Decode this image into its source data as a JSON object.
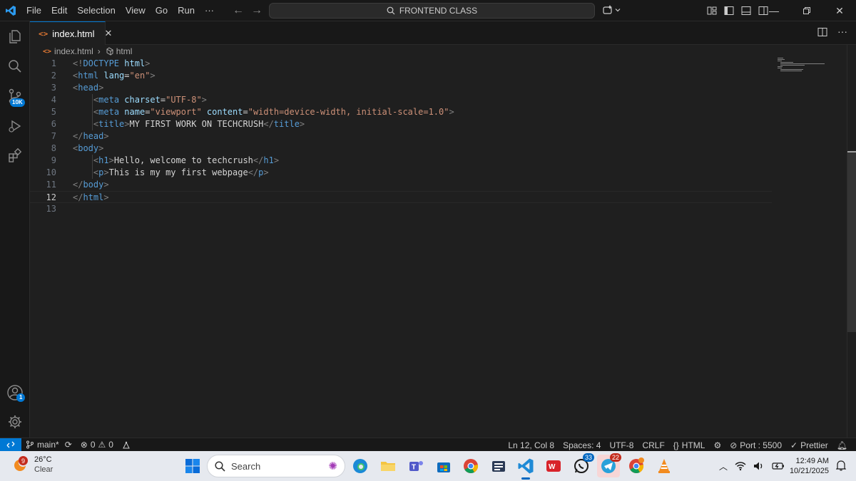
{
  "colors": {
    "accent": "#0078d4",
    "editor_bg": "#1f1f1f",
    "chrome_bg": "#181818",
    "taskbar_bg": "#e6e9ef"
  },
  "menu": [
    "File",
    "Edit",
    "Selection",
    "View",
    "Go",
    "Run",
    "···"
  ],
  "command_center": {
    "text": "FRONTEND CLASS",
    "icon": "search-icon"
  },
  "activity": {
    "source_control_badge": "10K",
    "accounts_badge": "1"
  },
  "tab": {
    "label": "index.html",
    "close": "✕"
  },
  "breadcrumb": {
    "file": "index.html",
    "symbol": "html"
  },
  "editor": {
    "current_line": "12",
    "line_numbers": [
      "1",
      "2",
      "3",
      "4",
      "5",
      "6",
      "7",
      "8",
      "9",
      "10",
      "11",
      "12",
      "13"
    ],
    "lines": [
      [
        [
          "t-tag",
          "<!"
        ],
        [
          "t-name",
          "DOCTYPE"
        ],
        [
          "t-text",
          " "
        ],
        [
          "t-attr",
          "html"
        ],
        [
          "t-tag",
          ">"
        ]
      ],
      [
        [
          "t-tag",
          "<"
        ],
        [
          "t-name",
          "html"
        ],
        [
          "t-text",
          " "
        ],
        [
          "t-attr",
          "lang"
        ],
        [
          "t-text",
          "="
        ],
        [
          "t-str",
          "\"en\""
        ],
        [
          "t-tag",
          ">"
        ]
      ],
      [
        [
          "t-tag",
          "<"
        ],
        [
          "t-name",
          "head"
        ],
        [
          "t-tag",
          ">"
        ]
      ],
      [
        [
          "t-text",
          "    "
        ],
        [
          "t-tag",
          "<"
        ],
        [
          "t-name",
          "meta"
        ],
        [
          "t-text",
          " "
        ],
        [
          "t-attr",
          "charset"
        ],
        [
          "t-text",
          "="
        ],
        [
          "t-str",
          "\"UTF-8\""
        ],
        [
          "t-tag",
          ">"
        ]
      ],
      [
        [
          "t-text",
          "    "
        ],
        [
          "t-tag",
          "<"
        ],
        [
          "t-name",
          "meta"
        ],
        [
          "t-text",
          " "
        ],
        [
          "t-attr",
          "name"
        ],
        [
          "t-text",
          "="
        ],
        [
          "t-str",
          "\"viewport\""
        ],
        [
          "t-text",
          " "
        ],
        [
          "t-attr",
          "content"
        ],
        [
          "t-text",
          "="
        ],
        [
          "t-str",
          "\"width=device-width, initial-scale=1.0\""
        ],
        [
          "t-tag",
          ">"
        ]
      ],
      [
        [
          "t-text",
          "    "
        ],
        [
          "t-tag",
          "<"
        ],
        [
          "t-name",
          "title"
        ],
        [
          "t-tag",
          ">"
        ],
        [
          "t-text",
          "MY FIRST WORK ON TECHCRUSH"
        ],
        [
          "t-tag",
          "</"
        ],
        [
          "t-name",
          "title"
        ],
        [
          "t-tag",
          ">"
        ]
      ],
      [
        [
          "t-tag",
          "</"
        ],
        [
          "t-name",
          "head"
        ],
        [
          "t-tag",
          ">"
        ]
      ],
      [
        [
          "t-tag",
          "<"
        ],
        [
          "t-name",
          "body"
        ],
        [
          "t-tag",
          ">"
        ]
      ],
      [
        [
          "t-text",
          "    "
        ],
        [
          "t-tag",
          "<"
        ],
        [
          "t-name",
          "h1"
        ],
        [
          "t-tag",
          ">"
        ],
        [
          "t-text",
          "Hello, welcome to techcrush"
        ],
        [
          "t-tag",
          "</"
        ],
        [
          "t-name",
          "h1"
        ],
        [
          "t-tag",
          ">"
        ]
      ],
      [
        [
          "t-text",
          "    "
        ],
        [
          "t-tag",
          "<"
        ],
        [
          "t-name",
          "p"
        ],
        [
          "t-tag",
          ">"
        ],
        [
          "t-text",
          "This is my my first webpage"
        ],
        [
          "t-tag",
          "</"
        ],
        [
          "t-name",
          "p"
        ],
        [
          "t-tag",
          ">"
        ]
      ],
      [
        [
          "t-tag",
          "</"
        ],
        [
          "t-name",
          "body"
        ],
        [
          "t-tag",
          ">"
        ]
      ],
      [
        [
          "t-tag",
          "</"
        ],
        [
          "t-name",
          "html"
        ],
        [
          "t-tag",
          ">"
        ]
      ],
      []
    ]
  },
  "status": {
    "branch": "main*",
    "errors": "0",
    "warnings": "0",
    "position": "Ln 12, Col 8",
    "spaces": "Spaces: 4",
    "encoding": "UTF-8",
    "eol": "CRLF",
    "language": "HTML",
    "port": "Port : 5500",
    "prettier": "Prettier"
  },
  "taskbar": {
    "weather_badge": "9",
    "temperature": "26°C",
    "condition": "Clear",
    "search_placeholder": "Search",
    "teams_badge": "33",
    "telegram_badge": "22",
    "time": "12:49 AM",
    "date": "10/21/2025"
  }
}
